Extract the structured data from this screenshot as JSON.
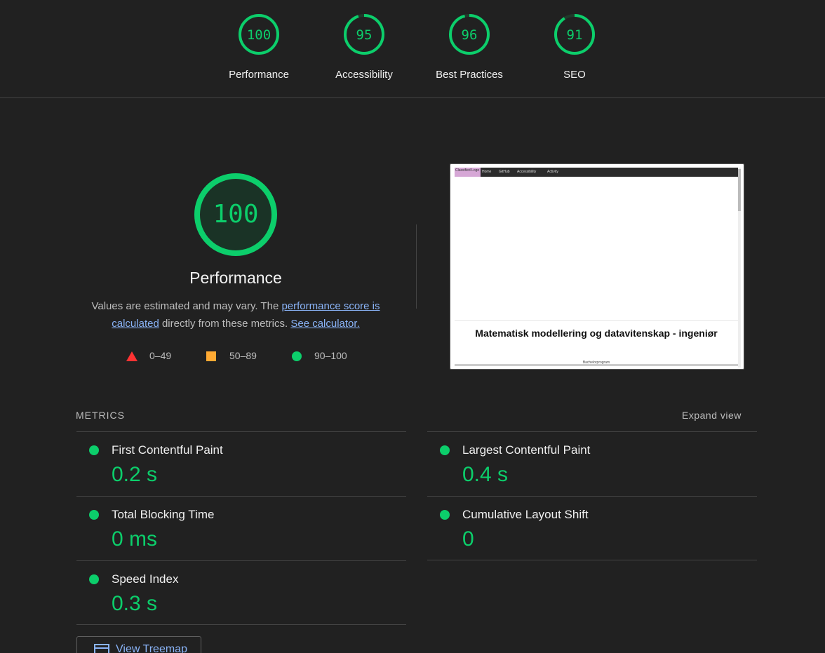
{
  "scores": [
    {
      "label": "Performance",
      "value": "100",
      "fraction": 1.0
    },
    {
      "label": "Accessibility",
      "value": "95",
      "fraction": 0.95
    },
    {
      "label": "Best Practices",
      "value": "96",
      "fraction": 0.96
    },
    {
      "label": "SEO",
      "value": "91",
      "fraction": 0.91
    }
  ],
  "performance": {
    "score": "100",
    "score_fraction": 1.0,
    "title": "Performance",
    "desc_prefix": "Values are estimated and may vary. The ",
    "desc_link1": "performance score is calculated",
    "desc_middle": " directly from these metrics. ",
    "desc_link2": "See calculator."
  },
  "legend": {
    "fail": "0–49",
    "average": "50–89",
    "pass": "90–100"
  },
  "screenshot": {
    "nav_logo": "Classified Logo",
    "nav_links": [
      "Home",
      "GitHub",
      "Accessibility",
      "Activity"
    ],
    "heading": "Matematisk modellering og datavitenskap - ingeniør",
    "subtext": "Bachelorprogram"
  },
  "metrics": {
    "label": "METRICS",
    "expand": "Expand view",
    "items": [
      {
        "title": "First Contentful Paint",
        "value": "0.2 s"
      },
      {
        "title": "Largest Contentful Paint",
        "value": "0.4 s"
      },
      {
        "title": "Total Blocking Time",
        "value": "0 ms"
      },
      {
        "title": "Cumulative Layout Shift",
        "value": "0"
      },
      {
        "title": "Speed Index",
        "value": "0.3 s"
      }
    ]
  },
  "treemap": {
    "label": "View Treemap"
  },
  "colors": {
    "pass": "#0cce6b",
    "average": "#ffaa33",
    "fail": "#ff3333",
    "link": "#8ab4f8",
    "background": "#212121"
  }
}
